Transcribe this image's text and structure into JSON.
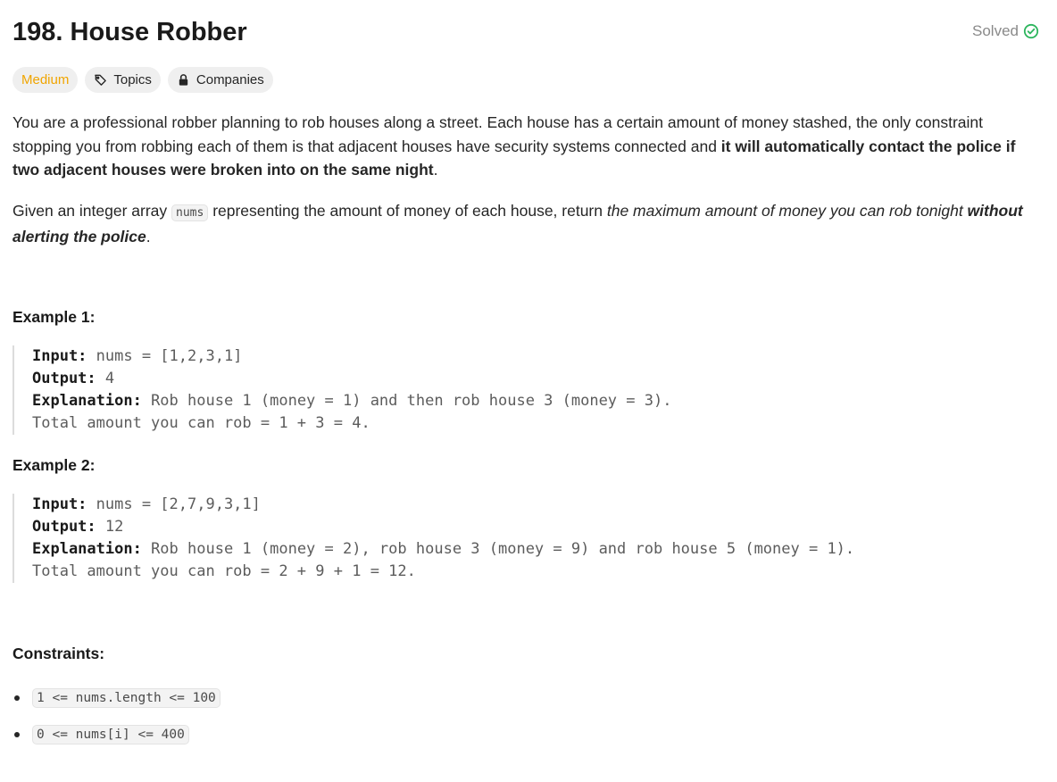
{
  "problem": {
    "title": "198. House Robber",
    "status": "Solved",
    "chips": {
      "difficulty": "Medium",
      "topics": "Topics",
      "companies": "Companies"
    }
  },
  "description": {
    "p1_normal": "You are a professional robber planning to rob houses along a street. Each house has a certain amount of money stashed, the only constraint stopping you from robbing each of them is that adjacent houses have security systems connected and ",
    "p1_bold": "it will automatically contact the police if two adjacent houses were broken into on the same night",
    "p1_end": ".",
    "p2_start": "Given an integer array ",
    "p2_code": "nums",
    "p2_mid": " representing the amount of money of each house, return ",
    "p2_italic": "the maximum amount of money you can rob tonight ",
    "p2_bolditalic": "without alerting the police",
    "p2_end": "."
  },
  "examples": [
    {
      "heading": "Example 1:",
      "input_label": "Input:",
      "input_value": " nums = [1,2,3,1]",
      "output_label": "Output:",
      "output_value": " 4",
      "explanation_label": "Explanation:",
      "explanation_value": " Rob house 1 (money = 1) and then rob house 3 (money = 3).",
      "explanation_line2": "Total amount you can rob = 1 + 3 = 4."
    },
    {
      "heading": "Example 2:",
      "input_label": "Input:",
      "input_value": " nums = [2,7,9,3,1]",
      "output_label": "Output:",
      "output_value": " 12",
      "explanation_label": "Explanation:",
      "explanation_value": " Rob house 1 (money = 2), rob house 3 (money = 9) and rob house 5 (money = 1).",
      "explanation_line2": "Total amount you can rob = 2 + 9 + 1 = 12."
    }
  ],
  "constraints": {
    "heading": "Constraints:",
    "items": [
      "1 <= nums.length <= 100",
      "0 <= nums[i] <= 400"
    ]
  },
  "colors": {
    "medium": "#f0a500",
    "solved_check": "#2db55d"
  }
}
